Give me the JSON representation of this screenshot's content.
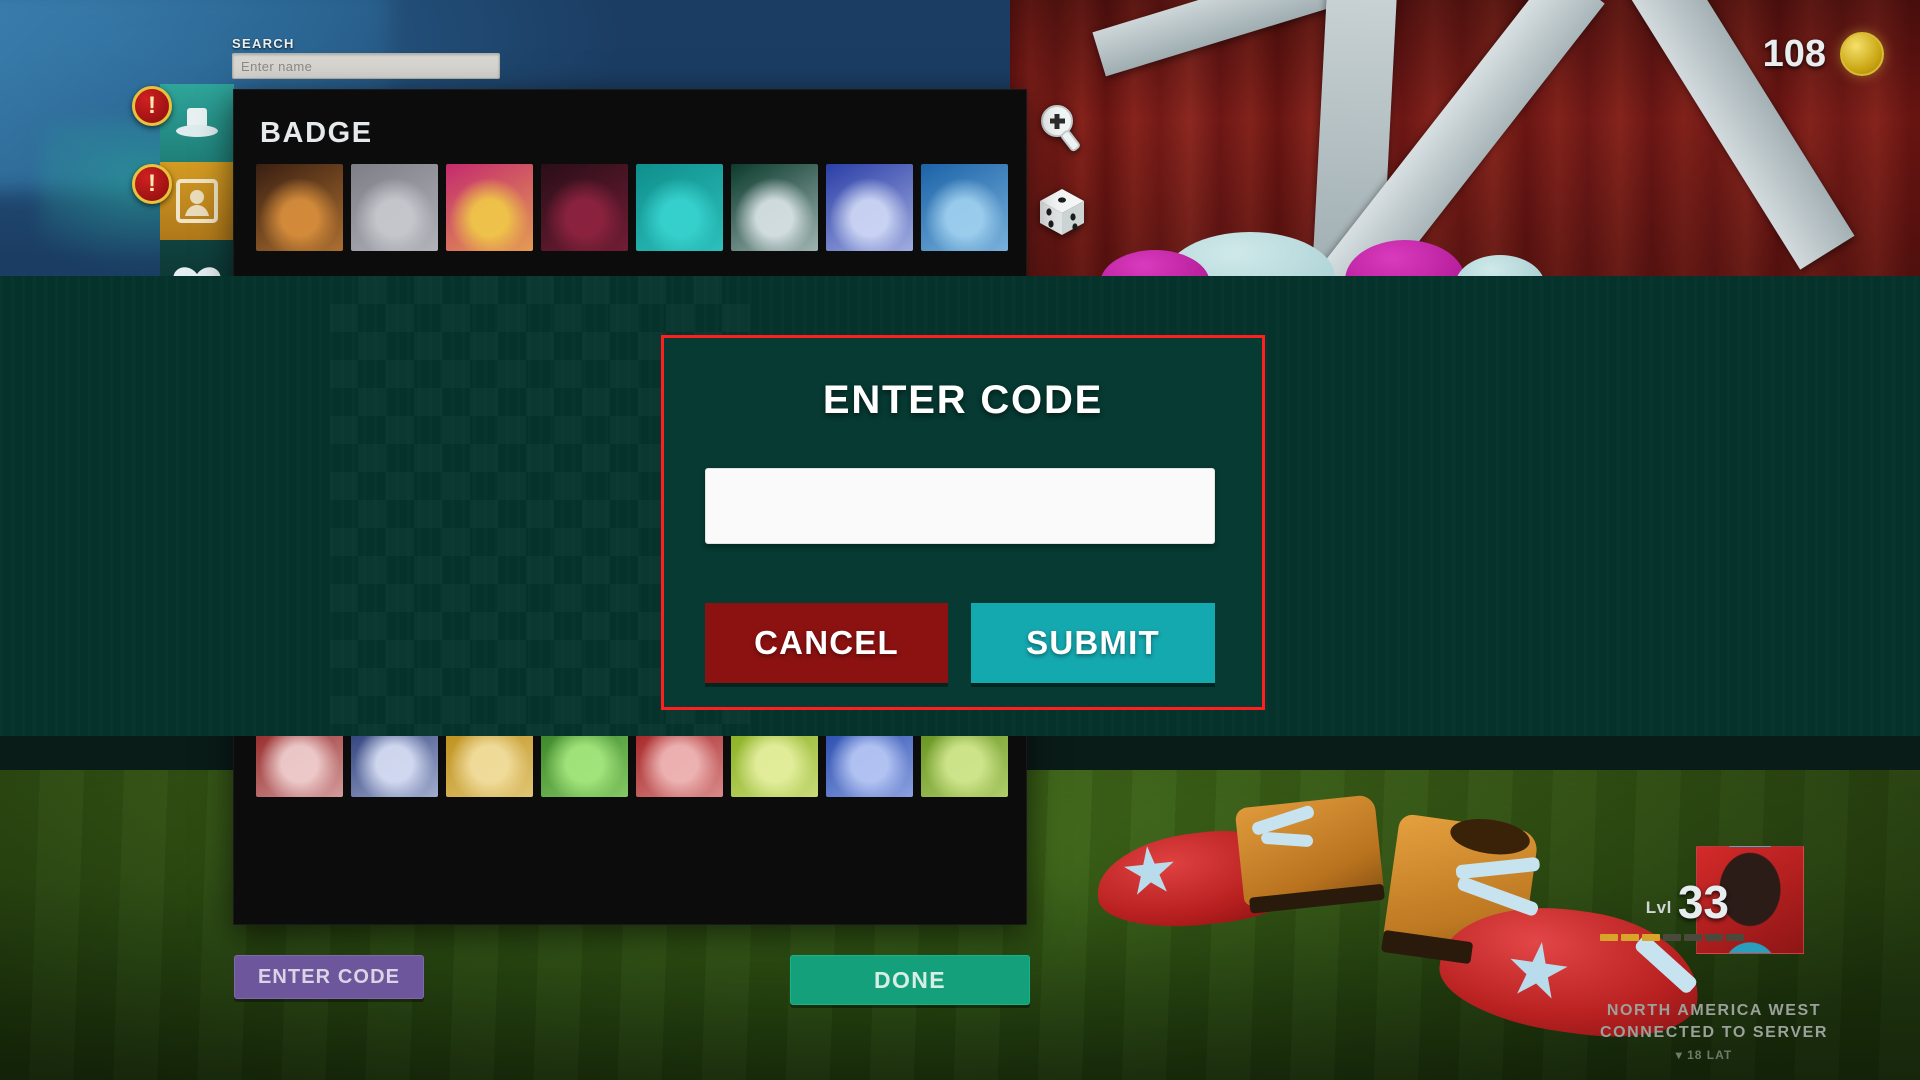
{
  "hud": {
    "coin_count": "108",
    "coin_icon": "gold-coin-icon",
    "level_label": "Lvl",
    "level_value": "33",
    "region": "NORTH AMERICA WEST",
    "status": "CONNECTED TO SERVER",
    "ping": "▾ 18 LAT",
    "xp_segments_filled": 3,
    "xp_segments_total": 7
  },
  "tools": {
    "zoom_icon": "magnifier-plus-icon",
    "dice_icon": "dice-randomize-icon"
  },
  "search": {
    "label": "SEARCH",
    "value": "",
    "placeholder": "Enter name"
  },
  "categories": [
    {
      "name": "hat",
      "icon": "top-hat-icon",
      "alert": true,
      "active": false
    },
    {
      "name": "badge",
      "icon": "portrait-frame-icon",
      "alert": true,
      "active": true
    },
    {
      "name": "mustache",
      "icon": "mustache-icon",
      "alert": false,
      "active": false
    }
  ],
  "panel": {
    "title": "BADGE",
    "badges": [
      {
        "bg": "#3a1f12",
        "fg": "#d98f3c"
      },
      {
        "bg": "#7e7e86",
        "fg": "#c7c9cf"
      },
      {
        "bg": "#c42b6e",
        "fg": "#f0c948"
      },
      {
        "bg": "#2a0e18",
        "fg": "#8e2340"
      },
      {
        "bg": "#0f8f8c",
        "fg": "#38d3cf"
      },
      {
        "bg": "#0c3b2d",
        "fg": "#d9e3e6"
      },
      {
        "bg": "#2b3fa8",
        "fg": "#cfd8f5"
      },
      {
        "bg": "#1b63a8",
        "fg": "#9fd0ef"
      },
      {
        "bg": "#1b1a22",
        "fg": "#e0a43c"
      },
      {
        "bg": "#3a1510",
        "fg": "#b6521f"
      },
      {
        "bg": "#4a2ba8",
        "fg": "#b6a4f0"
      },
      {
        "bg": "#1a1a1a",
        "fg": "#e8e8ea"
      },
      {
        "bg": "#2a0f3d",
        "fg": "#9a4be0"
      },
      {
        "bg": "#8d2550",
        "fg": "#e6a07e"
      },
      {
        "bg": "#173a1b",
        "fg": "#8fe08a"
      },
      {
        "bg": "#7a1620",
        "fg": "#e8b9bc"
      },
      {
        "bg": "#2a1d0f",
        "fg": "#d2a33e"
      },
      {
        "bg": "#0e2c4a",
        "fg": "#6fb4e8"
      },
      {
        "bg": "#3d0f0f",
        "fg": "#d85050"
      },
      {
        "bg": "#123a2a",
        "fg": "#57c493"
      },
      {
        "bg": "#3a2f10",
        "fg": "#d4c152"
      },
      {
        "bg": "#1a1030",
        "fg": "#7d6ae0"
      },
      {
        "bg": "#4a2010",
        "fg": "#e08f45"
      },
      {
        "bg": "#103a3a",
        "fg": "#4fd2d2"
      },
      {
        "bg": "#8c1616",
        "fg": "#f0d0d0"
      },
      {
        "bg": "#1b2e6e",
        "fg": "#d8dff5"
      },
      {
        "bg": "#b8860b",
        "fg": "#f2dfa0"
      },
      {
        "bg": "#2f7a1f",
        "fg": "#a6e87f"
      },
      {
        "bg": "#9e1414",
        "fg": "#f0b8b8"
      },
      {
        "bg": "#7ea812",
        "fg": "#e6f0a0"
      },
      {
        "bg": "#1a3fa8",
        "fg": "#b8c8f5"
      },
      {
        "bg": "#5a8a12",
        "fg": "#d2e88f"
      }
    ]
  },
  "footer": {
    "enter_code_label": "ENTER CODE",
    "done_label": "DONE"
  },
  "modal": {
    "title": "ENTER CODE",
    "input_value": "",
    "input_placeholder": "",
    "cancel_label": "CANCEL",
    "submit_label": "SUBMIT",
    "highlight_color": "#ff1f1f",
    "cancel_color": "#8c1111",
    "submit_color": "#14a8af"
  }
}
